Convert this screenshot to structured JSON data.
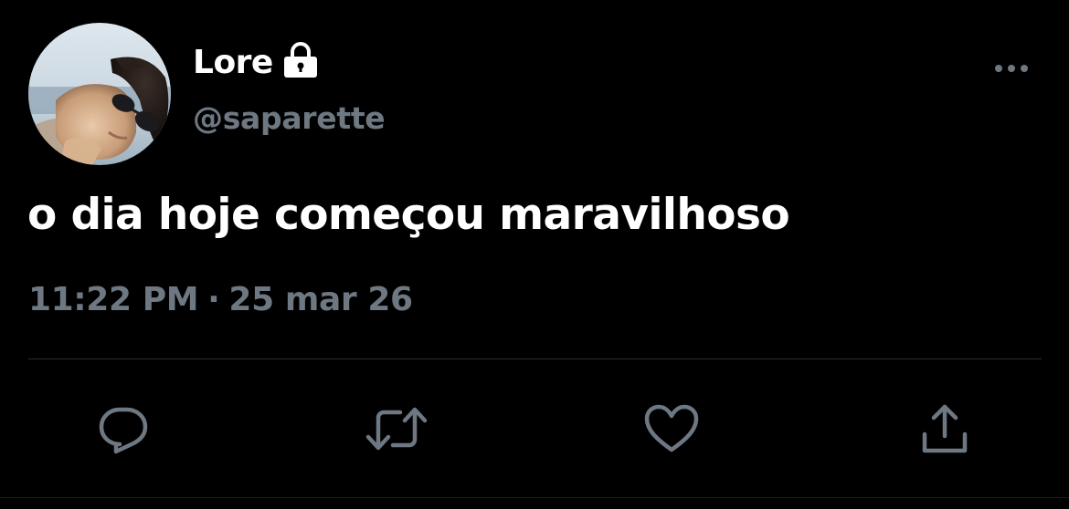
{
  "user": {
    "display_name": "Lore",
    "handle": "@saparette",
    "protected": true
  },
  "tweet": {
    "text": "o dia hoje começou maravilhoso",
    "time": "11:22 PM",
    "separator": "·",
    "date": "25 mar 26"
  },
  "actions": [
    {
      "name": "reply",
      "icon": "reply-icon"
    },
    {
      "name": "retweet",
      "icon": "retweet-icon"
    },
    {
      "name": "like",
      "icon": "heart-icon"
    },
    {
      "name": "share",
      "icon": "share-icon"
    }
  ],
  "colors": {
    "background": "#000000",
    "primary_text": "#ffffff",
    "secondary_text": "#6e7882",
    "divider": "#2a2f34"
  }
}
